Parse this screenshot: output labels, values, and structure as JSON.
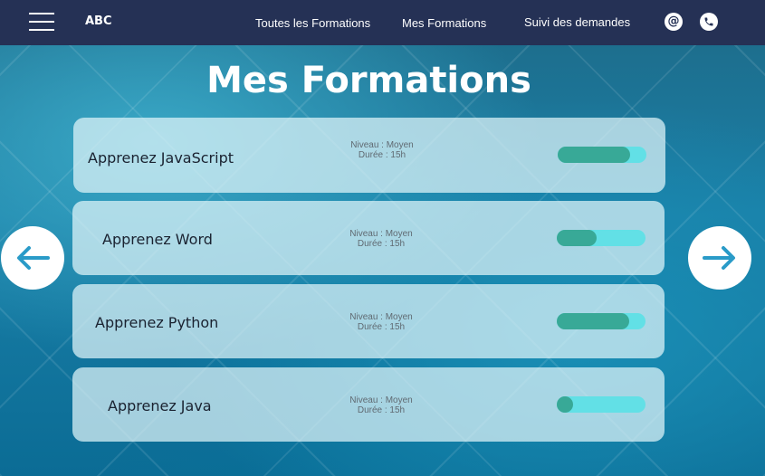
{
  "header": {
    "logo": "ABC",
    "nav": [
      "Toutes les Formations",
      "Mes Formations",
      "Suivi des demandes"
    ],
    "contact_icons": [
      "at-icon",
      "phone-icon"
    ]
  },
  "page": {
    "title": "Mes Formations"
  },
  "courses": [
    {
      "title": "Apprenez JavaScript",
      "level": "Niveau : Moyen",
      "duration": "Durée : 15h",
      "progress": 0.82
    },
    {
      "title": "Apprenez Word",
      "level": "Niveau : Moyen",
      "duration": "Durée : 15h",
      "progress": 0.45
    },
    {
      "title": "Apprenez Python",
      "level": "Niveau : Moyen",
      "duration": "Durée : 15h",
      "progress": 0.82
    },
    {
      "title": "Apprenez Java",
      "level": "Niveau : Moyen",
      "duration": "Durée : 15h",
      "progress": 0.18
    }
  ],
  "colors": {
    "header": "#253155",
    "progress_track": "#62e0e6",
    "progress_fill": "#38a997",
    "arrow": "#2a9bc8"
  }
}
